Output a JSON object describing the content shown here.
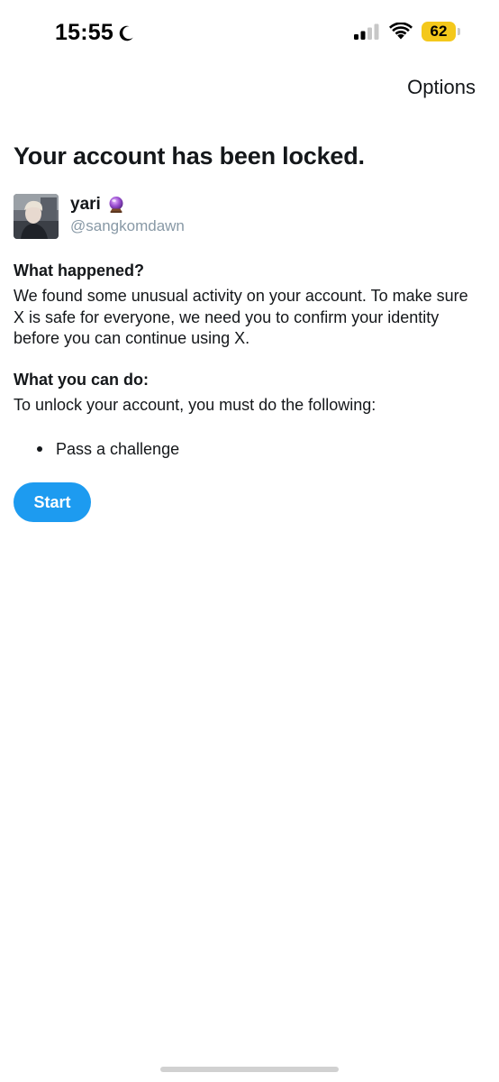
{
  "status_bar": {
    "time": "15:55",
    "battery_level": "62",
    "icons": [
      "moon-icon",
      "cellular-signal-icon",
      "wifi-icon",
      "battery-icon"
    ],
    "battery_color": "#f4c81b"
  },
  "header": {
    "options_label": "Options"
  },
  "main": {
    "title": "Your account has been locked.",
    "profile": {
      "display_name": "yari",
      "name_emoji_icon": "crystal-ball-icon",
      "username": "@sangkomdawn"
    },
    "what_happened": {
      "heading": "What happened?",
      "text": "We found some unusual activity on your account. To make sure X is safe for everyone, we need you to confirm your identity before you can continue using X."
    },
    "what_you_can_do": {
      "heading": "What you can do:",
      "text": "To unlock your account, you must do the following:",
      "items": [
        "Pass a challenge"
      ]
    },
    "start_button_label": "Start"
  },
  "colors": {
    "accent": "#1d9bf0",
    "text_primary": "#14171a",
    "text_secondary": "#8899a6"
  }
}
